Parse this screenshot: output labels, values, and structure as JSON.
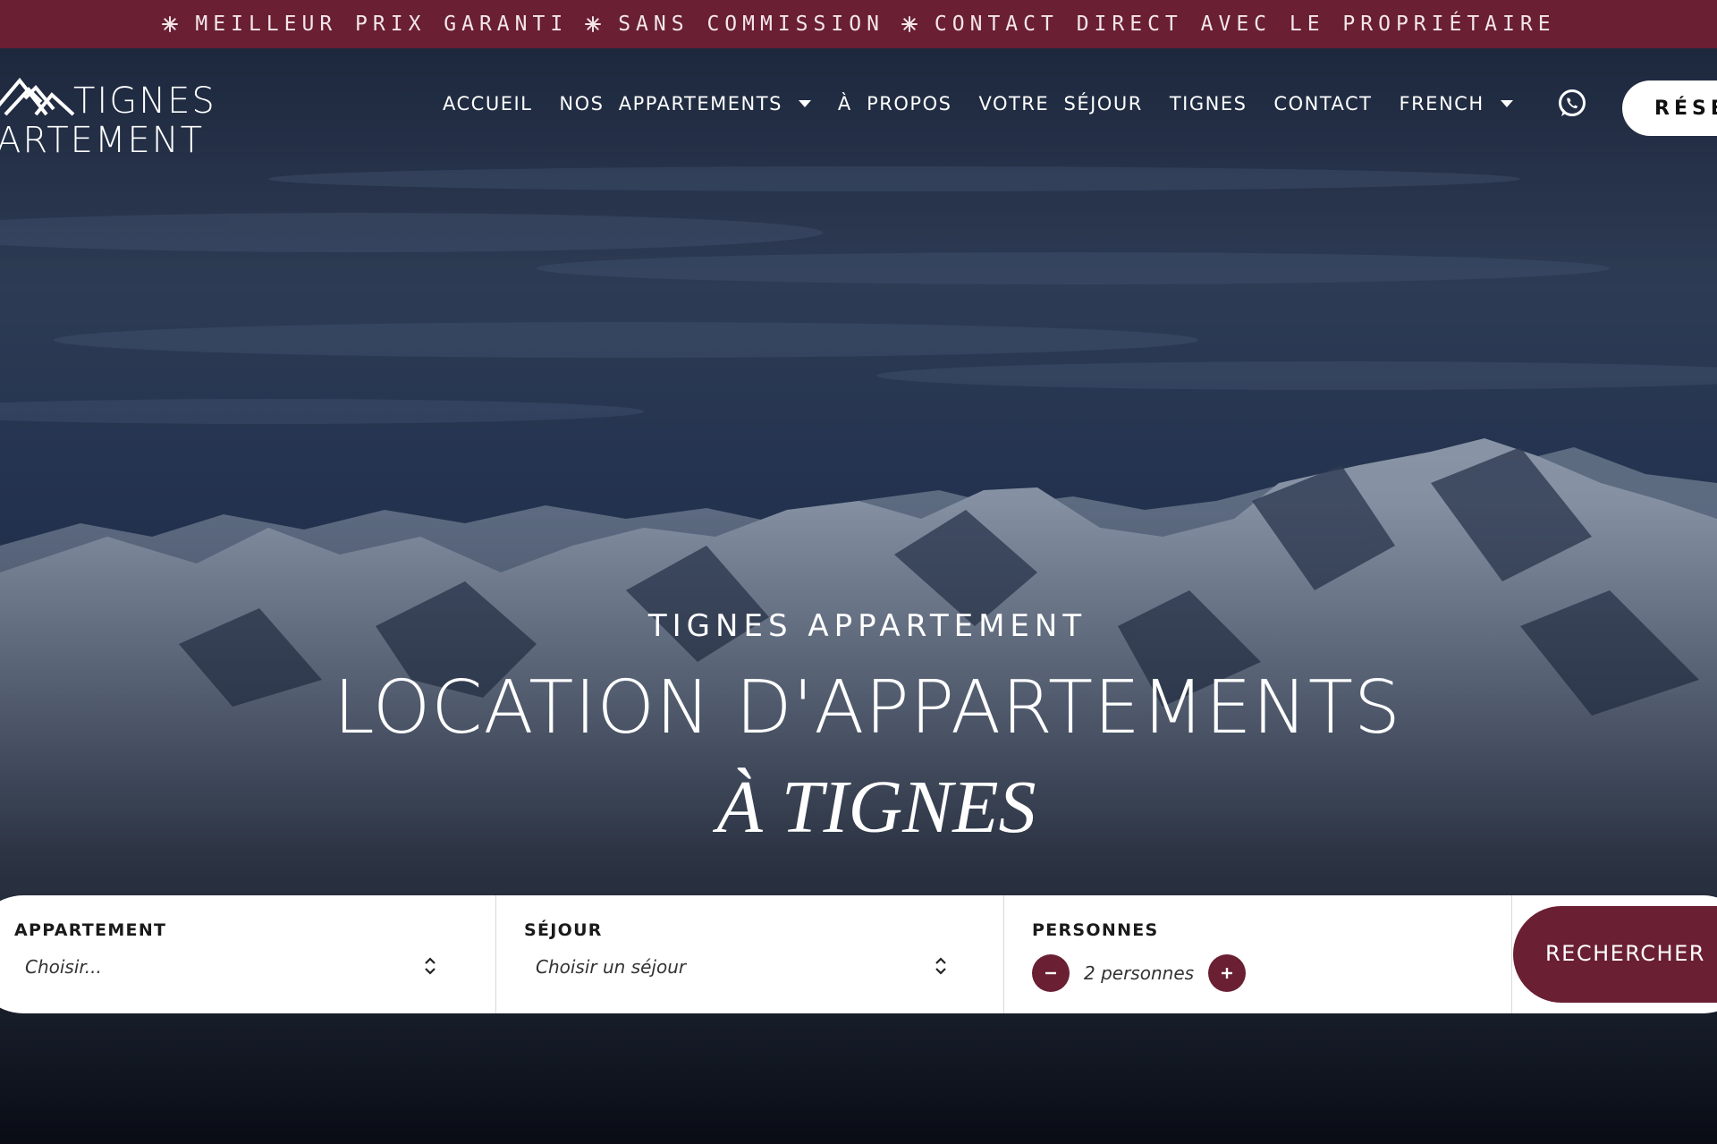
{
  "banner": {
    "item1": "MEILLEUR PRIX GARANTI",
    "item2": "SANS COMMISSION",
    "item3": "CONTACT DIRECT AVEC LE PROPRIÉTAIRE",
    "separator_icon": "asterisk-icon"
  },
  "logo": {
    "line1": "TIGNES",
    "line2": "ARTEMENT",
    "icon": "mountain-logo-icon"
  },
  "nav": {
    "items": [
      {
        "label": "ACCUEIL"
      },
      {
        "label": "NOS  APPARTEMENTS",
        "dropdown": true
      },
      {
        "label": "À  PROPOS"
      },
      {
        "label": "VOTRE  SÉJOUR"
      },
      {
        "label": "TIGNES"
      },
      {
        "label": "CONTACT"
      },
      {
        "label": "FRENCH",
        "dropdown": true
      }
    ],
    "whatsapp_icon": "whatsapp-icon",
    "reserve_label": "RÉSE"
  },
  "hero": {
    "eyebrow": "TIGNES APPARTEMENT",
    "title": "LOCATION D'APPARTEMENTS",
    "subtitle": "À TIGNES"
  },
  "search": {
    "appartement": {
      "label": "APPARTEMENT",
      "value": "Choisir..."
    },
    "sejour": {
      "label": "SÉJOUR",
      "value": "Choisir un séjour"
    },
    "personnes": {
      "label": "PERSONNES",
      "value": "2 personnes",
      "minus": "−",
      "plus": "+"
    },
    "button_label": "RECHERCHER"
  },
  "colors": {
    "brand": "#6a1f33",
    "white": "#ffffff",
    "hero_overlay": "#0e1628"
  }
}
